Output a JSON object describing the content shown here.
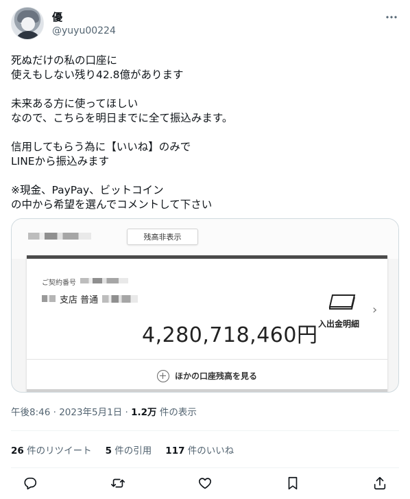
{
  "author": {
    "name": "優",
    "handle": "@yuyu00224"
  },
  "tweet_lines": [
    "死ぬだけの私の口座に",
    "使えもしない残り42.8億があります",
    "",
    "未来ある方に使ってほしい",
    "なので、こちらを明日までに全て振込みます。",
    "",
    "信用してもらう為に【いいね】のみで",
    "LINEから振込みます",
    "",
    "※現金、PayPay、ビットコイン",
    "の中から希望を選んでコメントして下さい"
  ],
  "bank_screenshot": {
    "toggle_label": "残高非表示",
    "contract_label": "ご契約番号",
    "branch_text": "支店 普通",
    "balance": "4,280,718,460円",
    "history_label": "入出金明細",
    "other_accounts_label": "ほかの口座残高を見る"
  },
  "meta": {
    "time": "午後8:46",
    "separator": " · ",
    "date": "2023年5月1日",
    "views_count": "1.2万",
    "views_label": " 件の表示"
  },
  "stats": {
    "retweets_count": "26",
    "retweets_label": " 件のリツイート",
    "quotes_count": "5",
    "quotes_label": " 件の引用",
    "likes_count": "117",
    "likes_label": " 件のいいね"
  },
  "icons": [
    "more-icon",
    "reply-icon",
    "retweet-icon",
    "like-icon",
    "bookmark-icon",
    "share-icon"
  ]
}
